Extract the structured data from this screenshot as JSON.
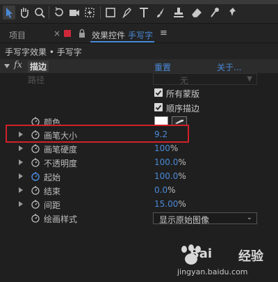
{
  "panel": {
    "project_tab": "项目",
    "effects_tab": "效果控件",
    "comp_name": "手写字",
    "menu_icon": "≡",
    "close_icon": "×"
  },
  "breadcrumb": "手写字效果 • 手写字",
  "effect": {
    "fx_label": "fx",
    "name": "描边",
    "reset": "重置",
    "about": "关于..."
  },
  "path": {
    "label": "路径",
    "value": "无"
  },
  "checkboxes": [
    {
      "label": "所有蒙版",
      "checked": true
    },
    {
      "label": "顺序描边",
      "checked": true
    }
  ],
  "color": {
    "label": "颜色",
    "swatch": "#ffffff"
  },
  "properties": [
    {
      "label": "画笔大小",
      "value": "9.2",
      "unit": ""
    },
    {
      "label": "画笔硬度",
      "value": "100",
      "unit": "%"
    },
    {
      "label": "不透明度",
      "value": "100.0",
      "unit": "%"
    },
    {
      "label": "起始",
      "value": "100.0",
      "unit": "%"
    },
    {
      "label": "结束",
      "value": "0.0",
      "unit": "%"
    },
    {
      "label": "间距",
      "value": "15.00",
      "unit": "%"
    }
  ],
  "paint_style": {
    "label": "绘画样式",
    "value": "显示原始图像"
  },
  "colors": {
    "accent": "#4a8ad8",
    "highlight": "#d2202a",
    "tab_red": "#d0283a"
  }
}
